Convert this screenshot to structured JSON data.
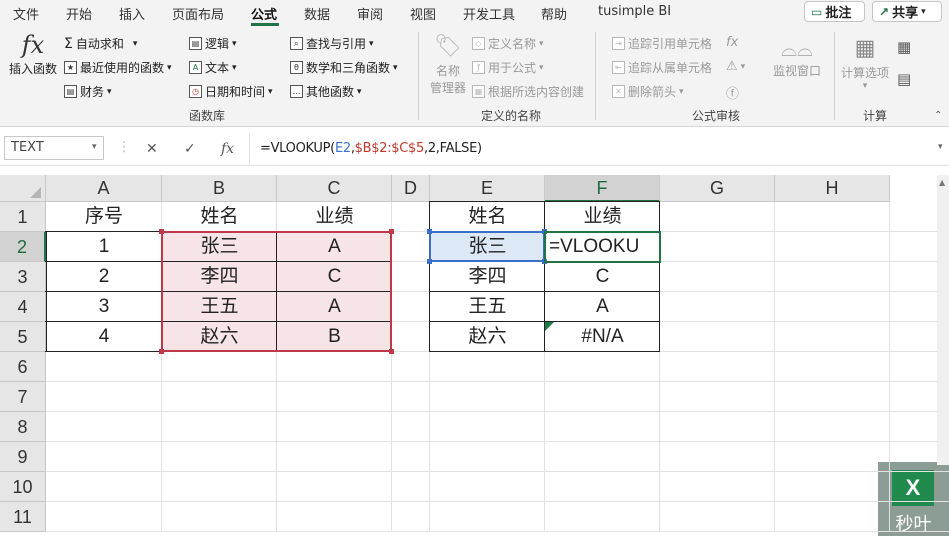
{
  "menu": {
    "tabs": [
      "文件",
      "开始",
      "插入",
      "页面布局",
      "公式",
      "数据",
      "审阅",
      "视图",
      "开发工具",
      "帮助",
      "tusimple BI"
    ],
    "comment_label": "批注",
    "share_label": "共享"
  },
  "ribbon": {
    "insert_function": {
      "icon": "fx",
      "label": "插入函数"
    },
    "library": {
      "autosum": "自动求和",
      "recent": "最近使用的函数",
      "finance": "财务",
      "logic": "逻辑",
      "text": "文本",
      "datetime": "日期和时间",
      "lookup": "查找与引用",
      "math": "数学和三角函数",
      "other": "其他函数",
      "group_label": "函数库"
    },
    "names": {
      "manager_line1": "名称",
      "manager_line2": "管理器",
      "define": "定义名称",
      "use_in_formula": "用于公式",
      "create_from_selection": "根据所选内容创建",
      "group_label": "定义的名称"
    },
    "audit": {
      "trace_precedents": "追踪引用单元格",
      "trace_dependents": "追踪从属单元格",
      "remove_arrows": "删除箭头",
      "watch_window": "监视窗口",
      "group_label": "公式审核"
    },
    "calc": {
      "options": "计算选项",
      "group_label": "计算"
    }
  },
  "formula_bar": {
    "name_box": "TEXT",
    "formula_parts": [
      {
        "text": "=VLOOKUP(",
        "color": "#222222"
      },
      {
        "text": "E2",
        "color": "#3a6fc7"
      },
      {
        "text": ",",
        "color": "#222222"
      },
      {
        "text": "$B$2:$C$5",
        "color": "#c0392b"
      },
      {
        "text": ",2,FALSE)",
        "color": "#222222"
      }
    ]
  },
  "sheet": {
    "columns": [
      "A",
      "B",
      "C",
      "D",
      "E",
      "F",
      "G",
      "H"
    ],
    "rows": [
      "1",
      "2",
      "3",
      "4",
      "5",
      "6",
      "7",
      "8",
      "9",
      "10",
      "11"
    ],
    "selected_column": "F",
    "selected_row": "2",
    "table1": {
      "headers": [
        "序号",
        "姓名",
        "业绩"
      ],
      "rows": [
        [
          "1",
          "张三",
          "A"
        ],
        [
          "2",
          "李四",
          "C"
        ],
        [
          "3",
          "王五",
          "A"
        ],
        [
          "4",
          "赵六",
          "B"
        ]
      ]
    },
    "table2": {
      "headers": [
        "姓名",
        "业绩"
      ],
      "rows": [
        [
          "张三",
          "=VLOOKU"
        ],
        [
          "李四",
          "C"
        ],
        [
          "王五",
          "A"
        ],
        [
          "赵六",
          "#N/A"
        ]
      ]
    },
    "highlight_color": "#f6e4e6",
    "range_border_color": "#c0394b",
    "ref_border_color": "#3a6fc7",
    "active_border_color": "#217346"
  },
  "watermark": {
    "text": "秒叶",
    "logo": "excel-logo"
  }
}
